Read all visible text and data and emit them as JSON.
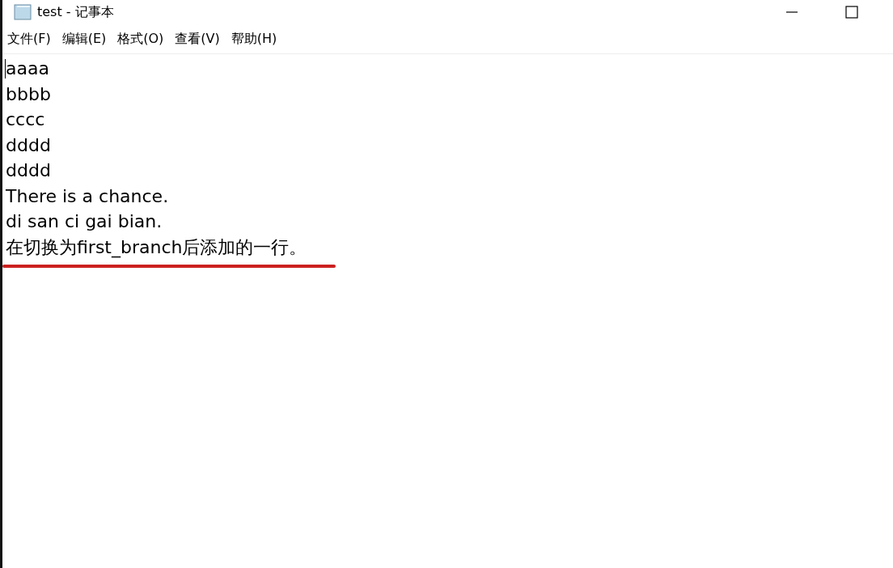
{
  "window": {
    "title": "test - 记事本"
  },
  "menu": [
    {
      "label": "文件(F)"
    },
    {
      "label": "编辑(E)"
    },
    {
      "label": "格式(O)"
    },
    {
      "label": "查看(V)"
    },
    {
      "label": "帮助(H)"
    }
  ],
  "editor": {
    "lines": [
      {
        "text": "aaaa",
        "underlined": false
      },
      {
        "text": "bbbb",
        "underlined": false
      },
      {
        "text": "cccc",
        "underlined": false
      },
      {
        "text": "dddd",
        "underlined": false
      },
      {
        "text": "dddd",
        "underlined": false
      },
      {
        "text": "There is a chance.",
        "underlined": false
      },
      {
        "text": "di san ci gai bian.",
        "underlined": false
      },
      {
        "text": "在切换为first_branch后添加的一行。",
        "underlined": true
      }
    ]
  }
}
